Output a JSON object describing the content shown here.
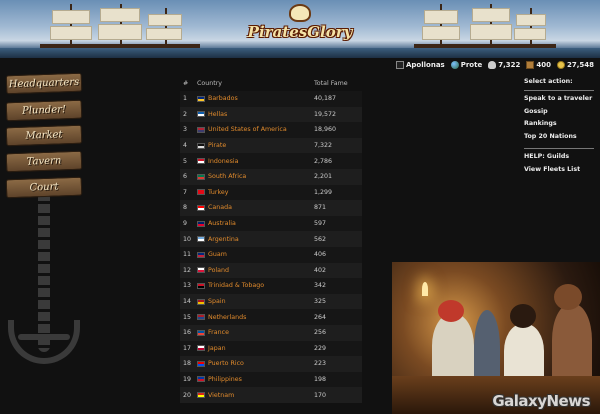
{
  "app": {
    "logo_text": "PiratesGlory"
  },
  "status": {
    "player": "Apollonas",
    "location": "Prote",
    "crew": "7,322",
    "cargo": "400",
    "gold": "27,548"
  },
  "nav": {
    "items": [
      {
        "label": "Headquarters"
      },
      {
        "label": "Plunder!"
      },
      {
        "label": "Market"
      },
      {
        "label": "Tavern"
      },
      {
        "label": "Court"
      }
    ]
  },
  "table": {
    "headers": {
      "num": "#",
      "country": "Country",
      "fame": "Total Fame"
    },
    "rows": [
      {
        "num": "1",
        "country": "Barbados",
        "fame": "40,187",
        "flag": [
          "#00267f",
          "#ffc726"
        ]
      },
      {
        "num": "2",
        "country": "Hellas",
        "fame": "19,572",
        "flag": [
          "#0d5eaf",
          "#ffffff"
        ]
      },
      {
        "num": "3",
        "country": "United States of America",
        "fame": "18,960",
        "flag": [
          "#b22234",
          "#3c3b6e"
        ]
      },
      {
        "num": "4",
        "country": "Pirate",
        "fame": "7,322",
        "flag": [
          "#111111",
          "#dddddd"
        ]
      },
      {
        "num": "5",
        "country": "Indonesia",
        "fame": "2,786",
        "flag": [
          "#ce1126",
          "#ffffff"
        ]
      },
      {
        "num": "6",
        "country": "South Africa",
        "fame": "2,201",
        "flag": [
          "#007a4d",
          "#de3831"
        ]
      },
      {
        "num": "7",
        "country": "Turkey",
        "fame": "1,299",
        "flag": [
          "#e30a17",
          "#e30a17"
        ]
      },
      {
        "num": "8",
        "country": "Canada",
        "fame": "871",
        "flag": [
          "#ff0000",
          "#ffffff"
        ]
      },
      {
        "num": "9",
        "country": "Australia",
        "fame": "597",
        "flag": [
          "#012169",
          "#e4002b"
        ]
      },
      {
        "num": "10",
        "country": "Argentina",
        "fame": "562",
        "flag": [
          "#74acdf",
          "#ffffff"
        ]
      },
      {
        "num": "11",
        "country": "Guam",
        "fame": "406",
        "flag": [
          "#00297b",
          "#c62139"
        ]
      },
      {
        "num": "12",
        "country": "Poland",
        "fame": "402",
        "flag": [
          "#ffffff",
          "#dc143c"
        ]
      },
      {
        "num": "13",
        "country": "Trinidad & Tobago",
        "fame": "342",
        "flag": [
          "#ce1126",
          "#000000"
        ]
      },
      {
        "num": "14",
        "country": "Spain",
        "fame": "325",
        "flag": [
          "#aa151b",
          "#f1bf00"
        ]
      },
      {
        "num": "15",
        "country": "Netherlands",
        "fame": "264",
        "flag": [
          "#ae1c28",
          "#21468b"
        ]
      },
      {
        "num": "16",
        "country": "France",
        "fame": "256",
        "flag": [
          "#0055a4",
          "#ef4135"
        ]
      },
      {
        "num": "17",
        "country": "Japan",
        "fame": "229",
        "flag": [
          "#ffffff",
          "#bc002d"
        ]
      },
      {
        "num": "18",
        "country": "Puerto Rico",
        "fame": "223",
        "flag": [
          "#ed0000",
          "#0050f0"
        ]
      },
      {
        "num": "19",
        "country": "Philippines",
        "fame": "198",
        "flag": [
          "#0038a8",
          "#ce1126"
        ]
      },
      {
        "num": "20",
        "country": "Vietnam",
        "fame": "170",
        "flag": [
          "#da251d",
          "#ffff00"
        ]
      }
    ]
  },
  "actions": {
    "heading": "Select action:",
    "links": [
      "Speak to a traveler",
      "Gossip",
      "Rankings",
      "Top 20 Nations"
    ],
    "help_links": [
      "HELP: Guilds",
      "View Fleets List"
    ]
  },
  "watermark": "GalaxyNews"
}
